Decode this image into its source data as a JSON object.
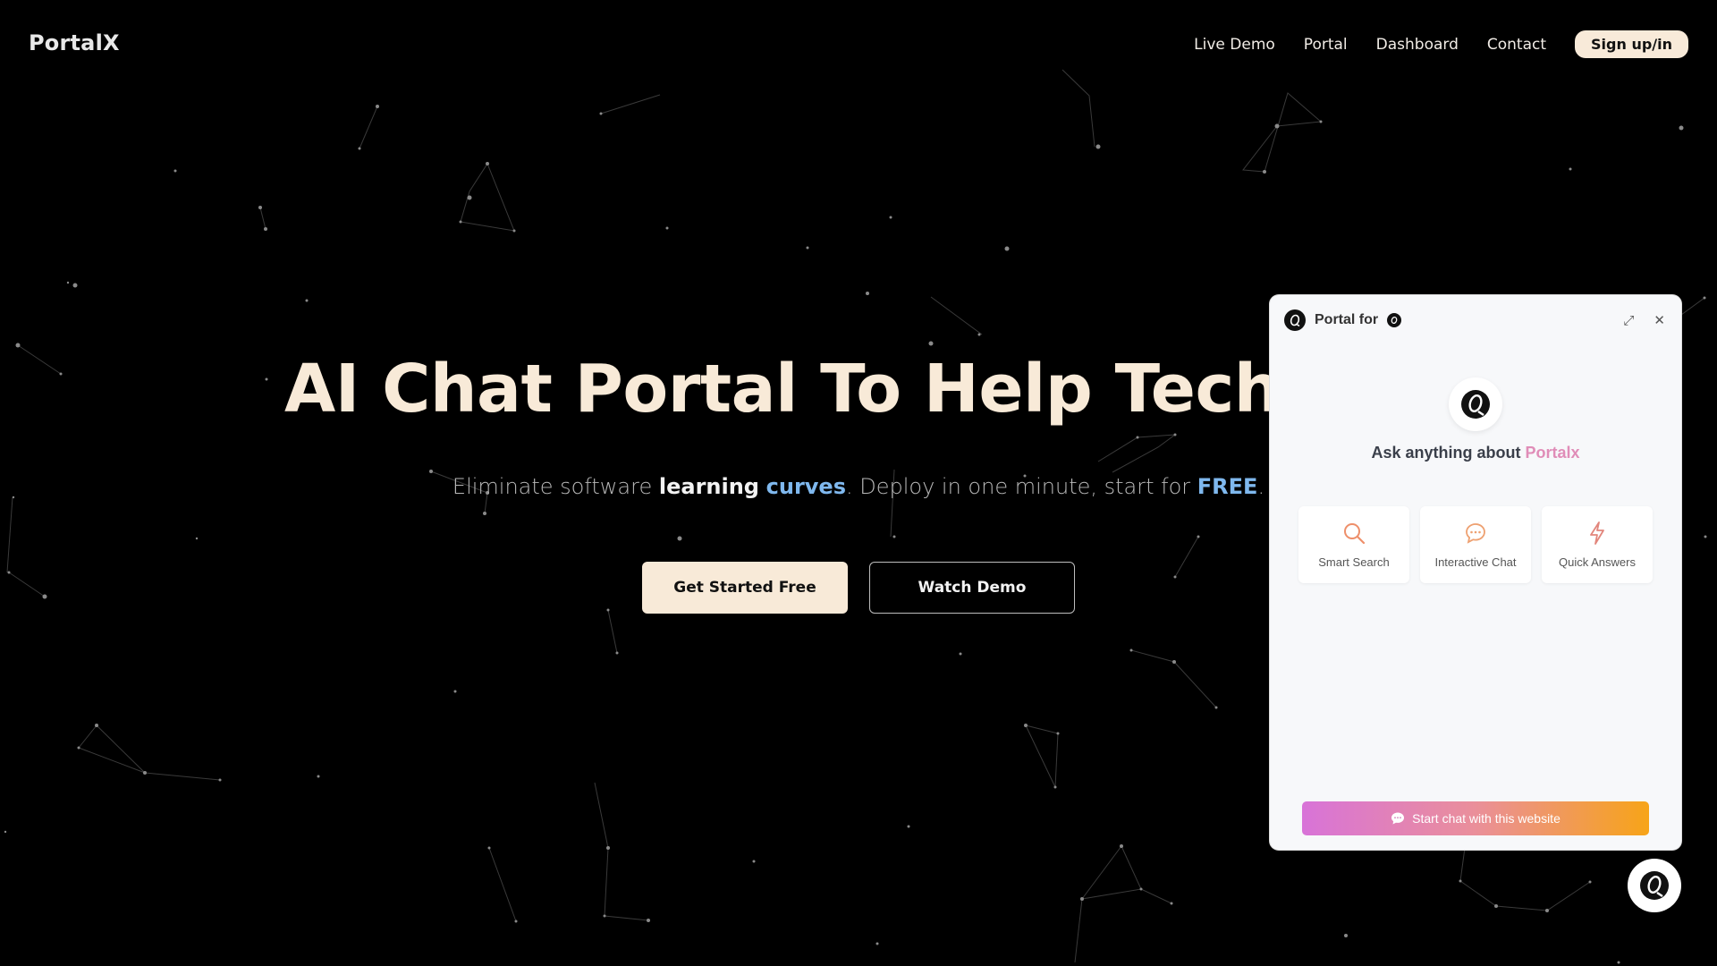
{
  "nav": {
    "logo": "PortalX",
    "links": [
      "Live Demo",
      "Portal",
      "Dashboard",
      "Contact"
    ],
    "signup_label": "Sign up/in"
  },
  "hero": {
    "title": "AI Chat Portal To Help Tech Ado",
    "subtitle_parts": {
      "p1": "Eliminate software ",
      "learning": "learning",
      "curves": "curves",
      "p2": ". Deploy in one minute, start for ",
      "free": "FREE",
      "p3": "."
    },
    "primary_button": "Get Started Free",
    "secondary_button": "Watch Demo"
  },
  "chat_panel": {
    "title": "Portal for",
    "ask_prefix": "Ask anything about ",
    "ask_brand": "Portalx",
    "features": [
      {
        "label": "Smart Search",
        "icon": "search-icon"
      },
      {
        "label": "Interactive Chat",
        "icon": "chat-bubble-icon"
      },
      {
        "label": "Quick Answers",
        "icon": "lightning-icon"
      }
    ],
    "start_chat_label": "Start chat with this website"
  },
  "colors": {
    "background": "#000000",
    "hero_text": "#f8ead8",
    "accent_blue": "#7fb8ee",
    "gradient_start": "#d873d8",
    "gradient_end": "#f7a418"
  }
}
